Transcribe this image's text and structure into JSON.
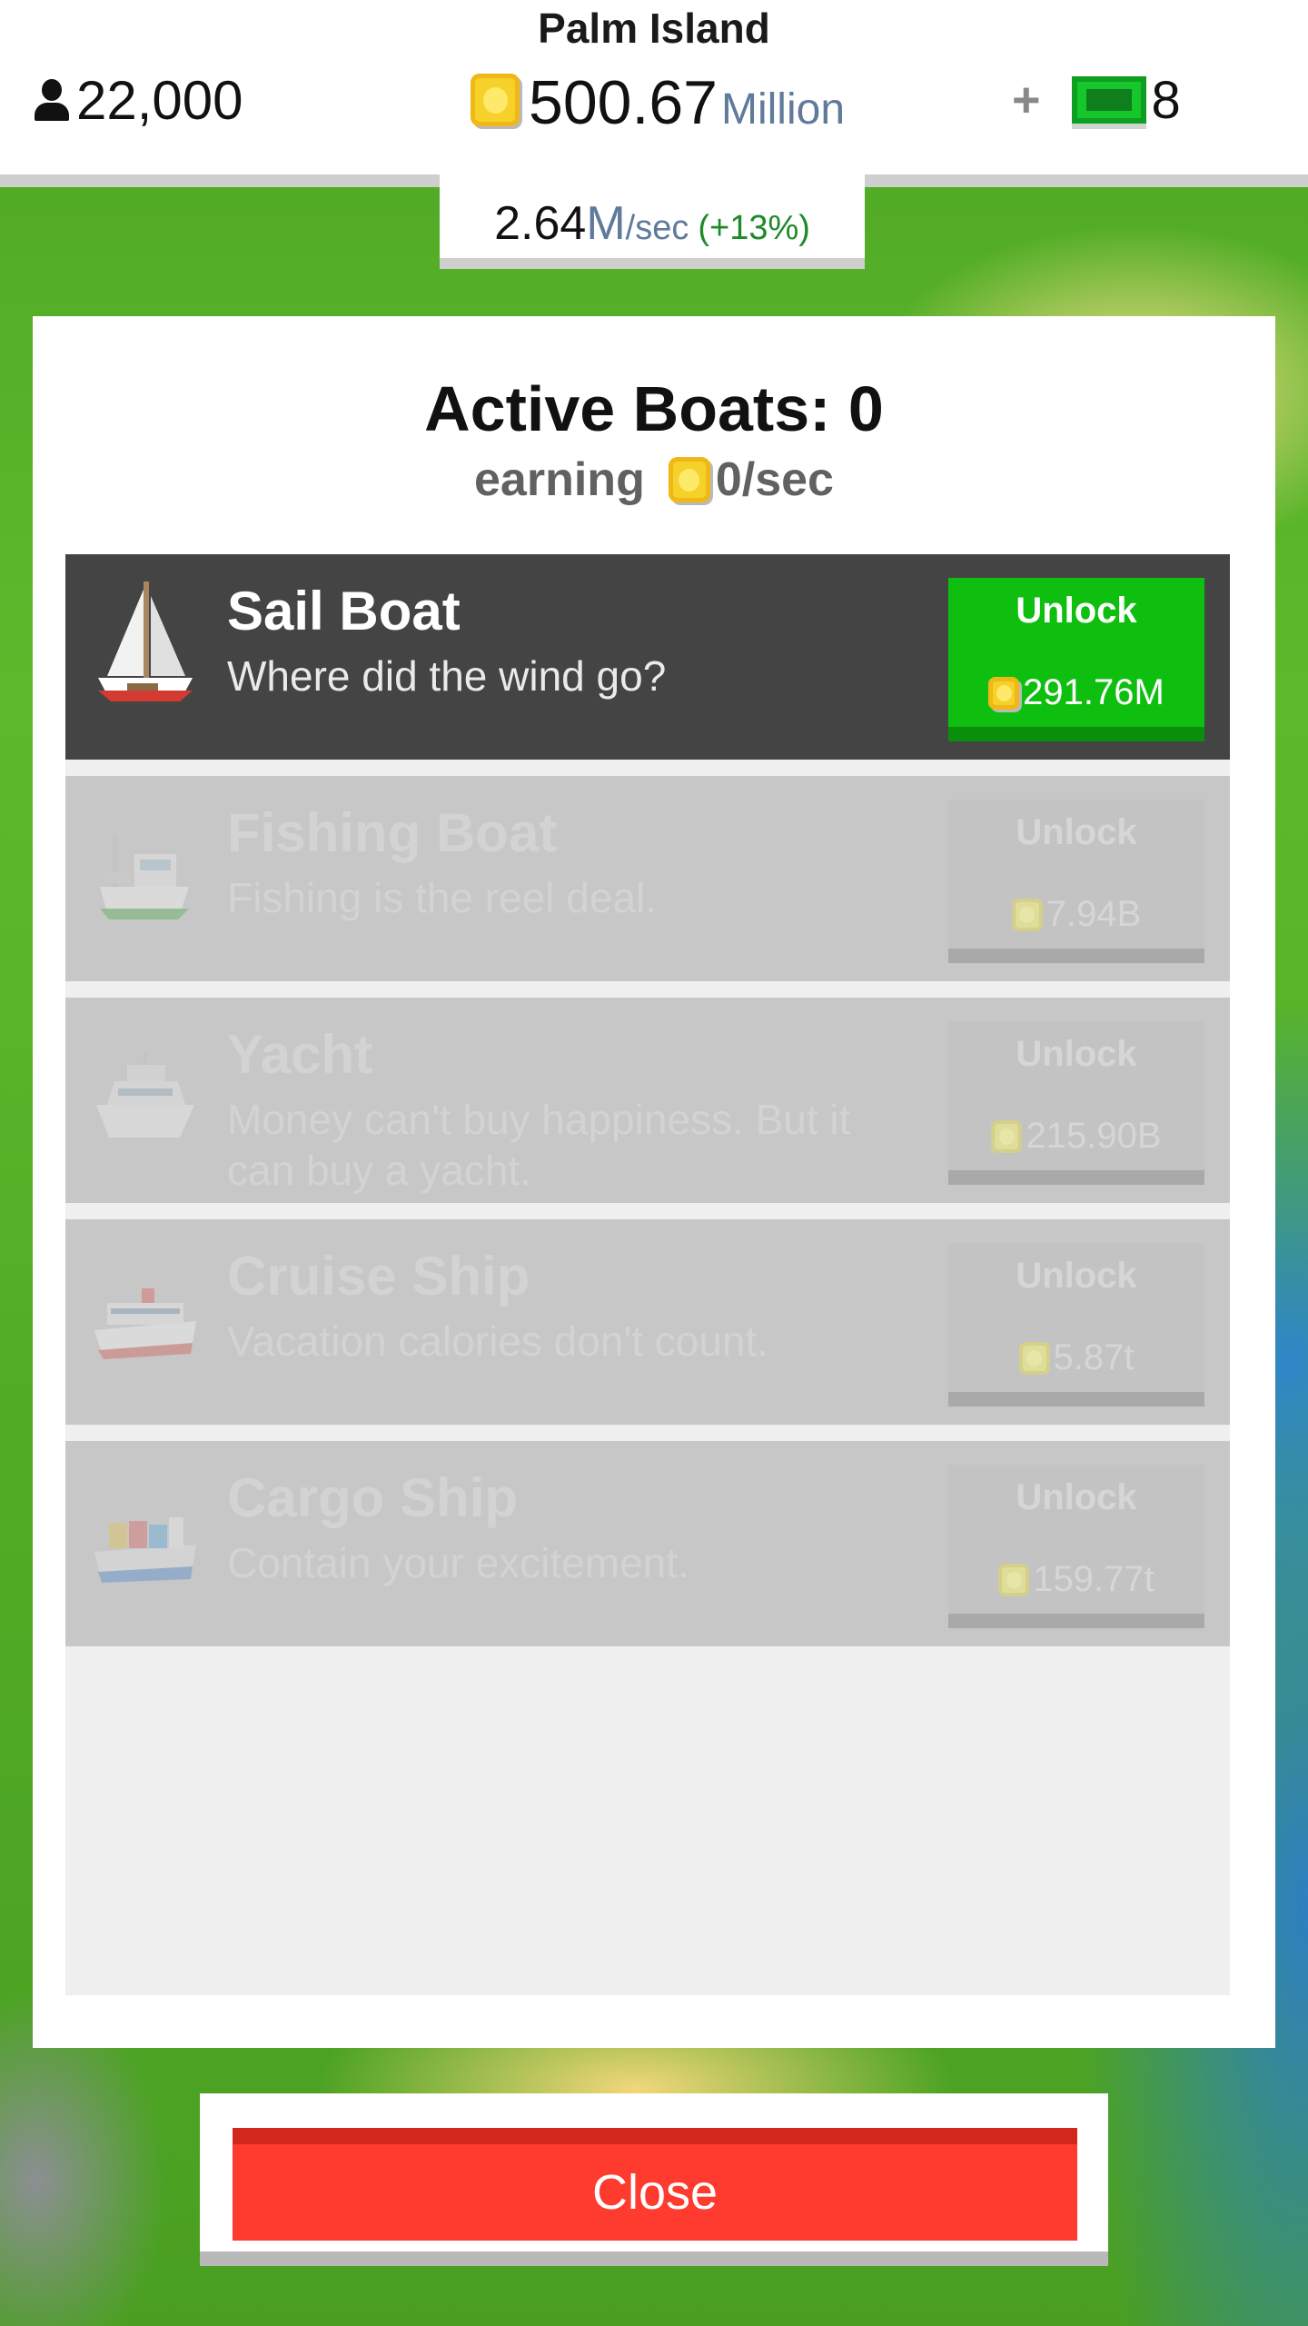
{
  "hud": {
    "island_name": "Palm Island",
    "population": "22,000",
    "money_value": "500.67",
    "money_unit": "Million",
    "plus_label": "+",
    "gems": "8",
    "rate_value": "2.64",
    "rate_unit_m": "M",
    "rate_unit_s": "/sec",
    "rate_bonus": "(+13%)"
  },
  "panel": {
    "title": "Active Boats: 0",
    "earning_label": "earning",
    "earning_value": "0/sec",
    "boats": [
      {
        "name": "Sail Boat",
        "desc": "Where did the wind go?",
        "button": "Unlock",
        "price": "291.76M",
        "icon": "sail-boat-icon",
        "state": "available"
      },
      {
        "name": "Fishing Boat",
        "desc": "Fishing is the reel deal.",
        "button": "Unlock",
        "price": "7.94B",
        "icon": "fishing-boat-icon",
        "state": "locked"
      },
      {
        "name": "Yacht",
        "desc": "Money can't buy happiness. But it can buy a yacht.",
        "button": "Unlock",
        "price": "215.90B",
        "icon": "yacht-icon",
        "state": "locked"
      },
      {
        "name": "Cruise Ship",
        "desc": "Vacation calories don't count.",
        "button": "Unlock",
        "price": "5.87t",
        "icon": "cruise-ship-icon",
        "state": "locked"
      },
      {
        "name": "Cargo Ship",
        "desc": "Contain your excitement.",
        "button": "Unlock",
        "price": "159.77t",
        "icon": "cargo-ship-icon",
        "state": "locked"
      }
    ]
  },
  "footer": {
    "close_label": "Close"
  },
  "colors": {
    "unlock_active": "#0fbf0f",
    "close": "#ff3a2e",
    "row_active": "#444444",
    "row_locked": "#c7c7c7"
  }
}
